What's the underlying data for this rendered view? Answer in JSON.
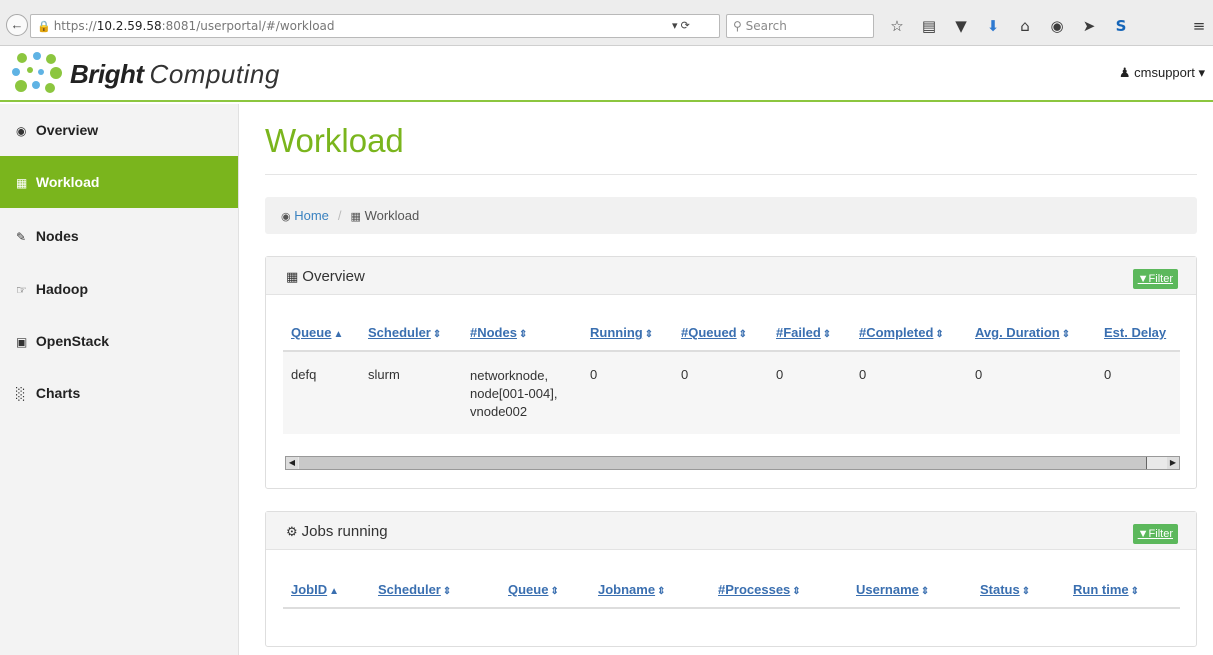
{
  "browser": {
    "url_prefix": "https://",
    "url_host": "10.2.59.58",
    "url_rest": ":8081/userportal/#/workload",
    "search_placeholder": "Search"
  },
  "header": {
    "brand_bold": "Bright",
    "brand_light": "Computing",
    "user": "cmsupport"
  },
  "sidebar": {
    "items": [
      {
        "label": "Overview",
        "icon": "dashboard-icon"
      },
      {
        "label": "Workload",
        "icon": "table-icon"
      },
      {
        "label": "Nodes",
        "icon": "edit-icon"
      },
      {
        "label": "Hadoop",
        "icon": "hand-icon"
      },
      {
        "label": "OpenStack",
        "icon": "stop-icon"
      },
      {
        "label": "Charts",
        "icon": "bar-chart-icon"
      }
    ],
    "active": "Workload"
  },
  "page": {
    "title": "Workload",
    "breadcrumb": [
      "Home",
      "Workload"
    ]
  },
  "overview_panel": {
    "title": "Overview",
    "filter_label": "Filter",
    "columns": [
      "Queue",
      "Scheduler",
      "#Nodes",
      "Running",
      "#Queued",
      "#Failed",
      "#Completed",
      "Avg. Duration",
      "Est. Delay"
    ],
    "rows": [
      {
        "queue": "defq",
        "scheduler": "slurm",
        "nodes": [
          "networknode,",
          "node[001-004],",
          "vnode002"
        ],
        "running": "0",
        "queued": "0",
        "failed": "0",
        "completed": "0",
        "avg_duration": "0",
        "est_delay": "0"
      }
    ]
  },
  "jobs_panel": {
    "title": "Jobs running",
    "filter_label": "Filter",
    "columns": [
      "JobID",
      "Scheduler",
      "Queue",
      "Jobname",
      "#Processes",
      "Username",
      "Status",
      "Run time"
    ],
    "rows": []
  },
  "colors": {
    "accent": "#7ab51d",
    "link": "#3a6fb0",
    "filter": "#5cb85c"
  }
}
